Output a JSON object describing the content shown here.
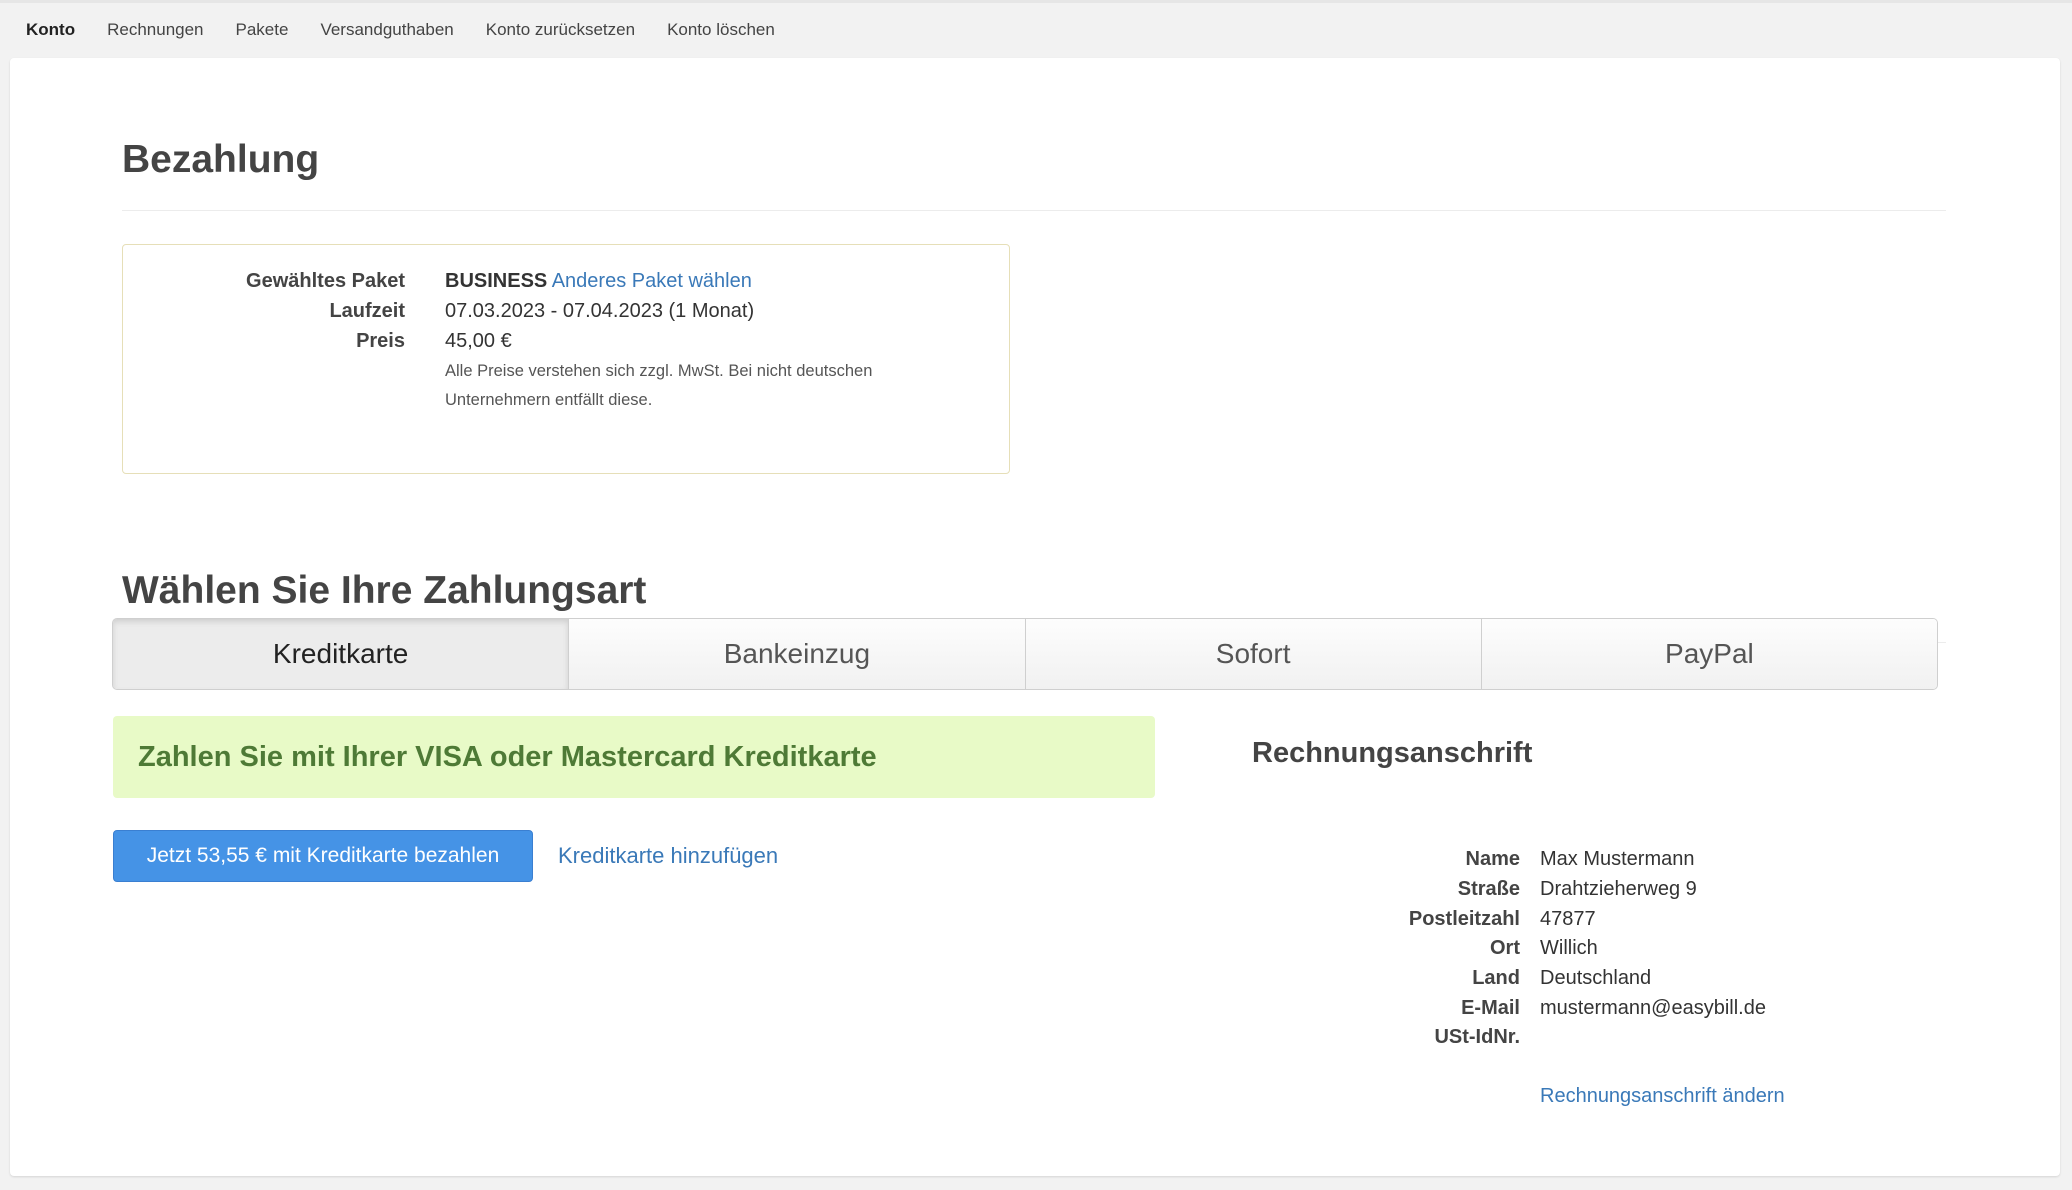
{
  "nav": {
    "items": [
      "Konto",
      "Rechnungen",
      "Pakete",
      "Versandguthaben",
      "Konto zurücksetzen",
      "Konto löschen"
    ]
  },
  "payment": {
    "title": "Bezahlung",
    "package_label": "Gewähltes Paket",
    "package_value": "BUSINESS",
    "package_change": "Anderes Paket wählen",
    "term_label": "Laufzeit",
    "term_value": "07.03.2023 - 07.04.2023 (1 Monat)",
    "price_label": "Preis",
    "price_value": "45,00 €",
    "price_note_line1": "Alle Preise verstehen sich zzgl. MwSt. Bei nicht deutschen",
    "price_note_line2": "Unternehmern entfällt diese."
  },
  "method": {
    "title": "Wählen Sie Ihre Zahlungsart",
    "tabs": [
      "Kreditkarte",
      "Bankeinzug",
      "Sofort",
      "PayPal"
    ],
    "active_tab": "Kreditkarte",
    "alert": "Zahlen Sie mit Ihrer VISA oder Mastercard Kreditkarte",
    "pay_button": "Jetzt 53,55 € mit Kreditkarte bezahlen",
    "add_card": "Kreditkarte hinzufügen"
  },
  "billing": {
    "title": "Rechnungsanschrift",
    "fields": [
      {
        "label": "Name",
        "value": "Max Mustermann"
      },
      {
        "label": "Straße",
        "value": "Drahtzieherweg 9"
      },
      {
        "label": "Postleitzahl",
        "value": "47877"
      },
      {
        "label": "Ort",
        "value": "Willich"
      },
      {
        "label": "Land",
        "value": "Deutschland"
      },
      {
        "label": "E-Mail",
        "value": "mustermann@easybill.de"
      },
      {
        "label": "USt-IdNr.",
        "value": ""
      }
    ],
    "edit_link": "Rechnungsanschrift ändern"
  },
  "colors": {
    "link": "#3a79b8",
    "primary_button": "#4593e6",
    "alert_bg": "#e8fac7",
    "alert_text": "#4e7a36"
  }
}
